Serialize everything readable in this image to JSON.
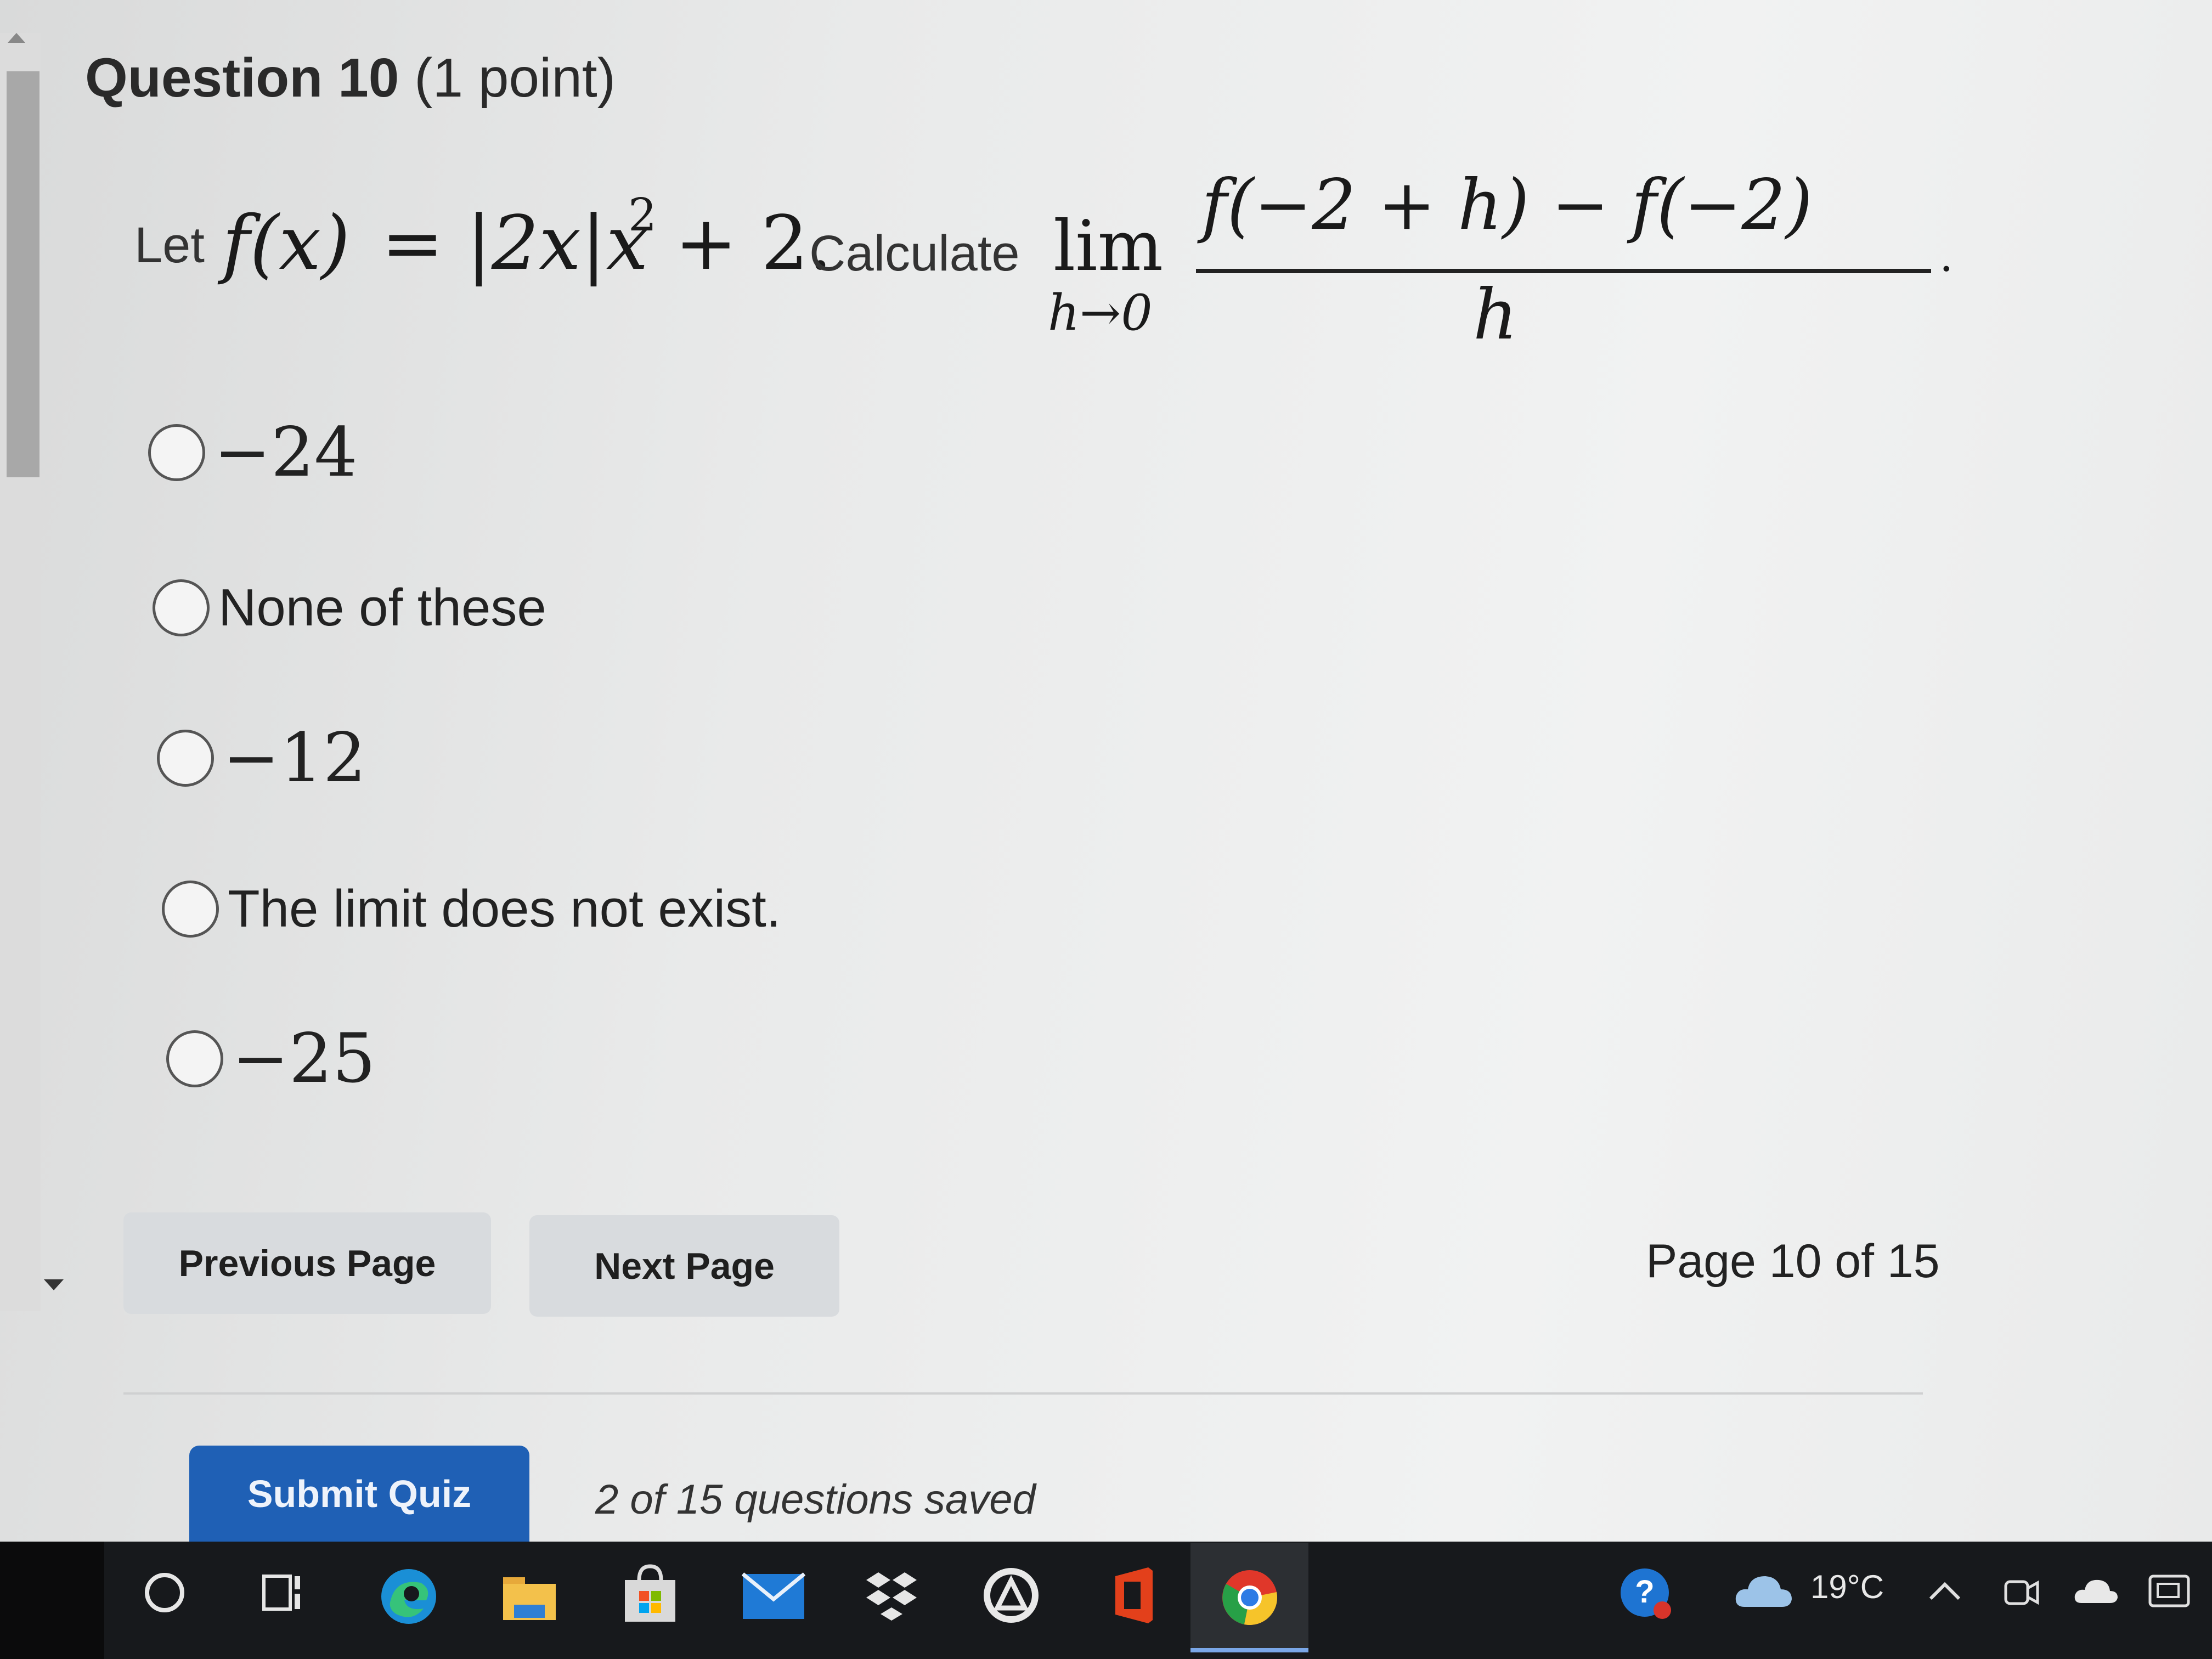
{
  "question": {
    "number_label": "Question 10",
    "points_label": "(1 point)"
  },
  "problem": {
    "let_word": "Let",
    "f_of_x": "f(x)",
    "equals": "=",
    "expression": "|2x|x",
    "exponent": "2",
    "plus_two": "+ 2.",
    "calculate_word": "Calculate",
    "lim": "lim",
    "lim_sub": "h→0",
    "numerator": "f(−2 + h) − f(−2)",
    "denominator": "h",
    "period": "."
  },
  "options": [
    {
      "label": "−24"
    },
    {
      "label": "None of these"
    },
    {
      "label": "−12"
    },
    {
      "label": "The limit does not exist."
    },
    {
      "label": "−25"
    }
  ],
  "nav": {
    "previous_label": "Previous Page",
    "next_label": "Next Page",
    "page_indicator": "Page 10 of 15"
  },
  "footer": {
    "submit_label": "Submit Quiz",
    "saved_status": "2 of 15 questions saved"
  },
  "taskbar": {
    "icons": [
      "start-icon",
      "task-view-icon",
      "edge-icon",
      "file-explorer-icon",
      "store-icon",
      "mail-icon",
      "dropbox-icon",
      "app-icon",
      "office-icon",
      "chrome-icon"
    ],
    "temperature": "19°C"
  },
  "colors": {
    "submit_blue": "#1f60b5",
    "nav_button_gray": "#d8dbde",
    "taskbar": "#17191c"
  }
}
